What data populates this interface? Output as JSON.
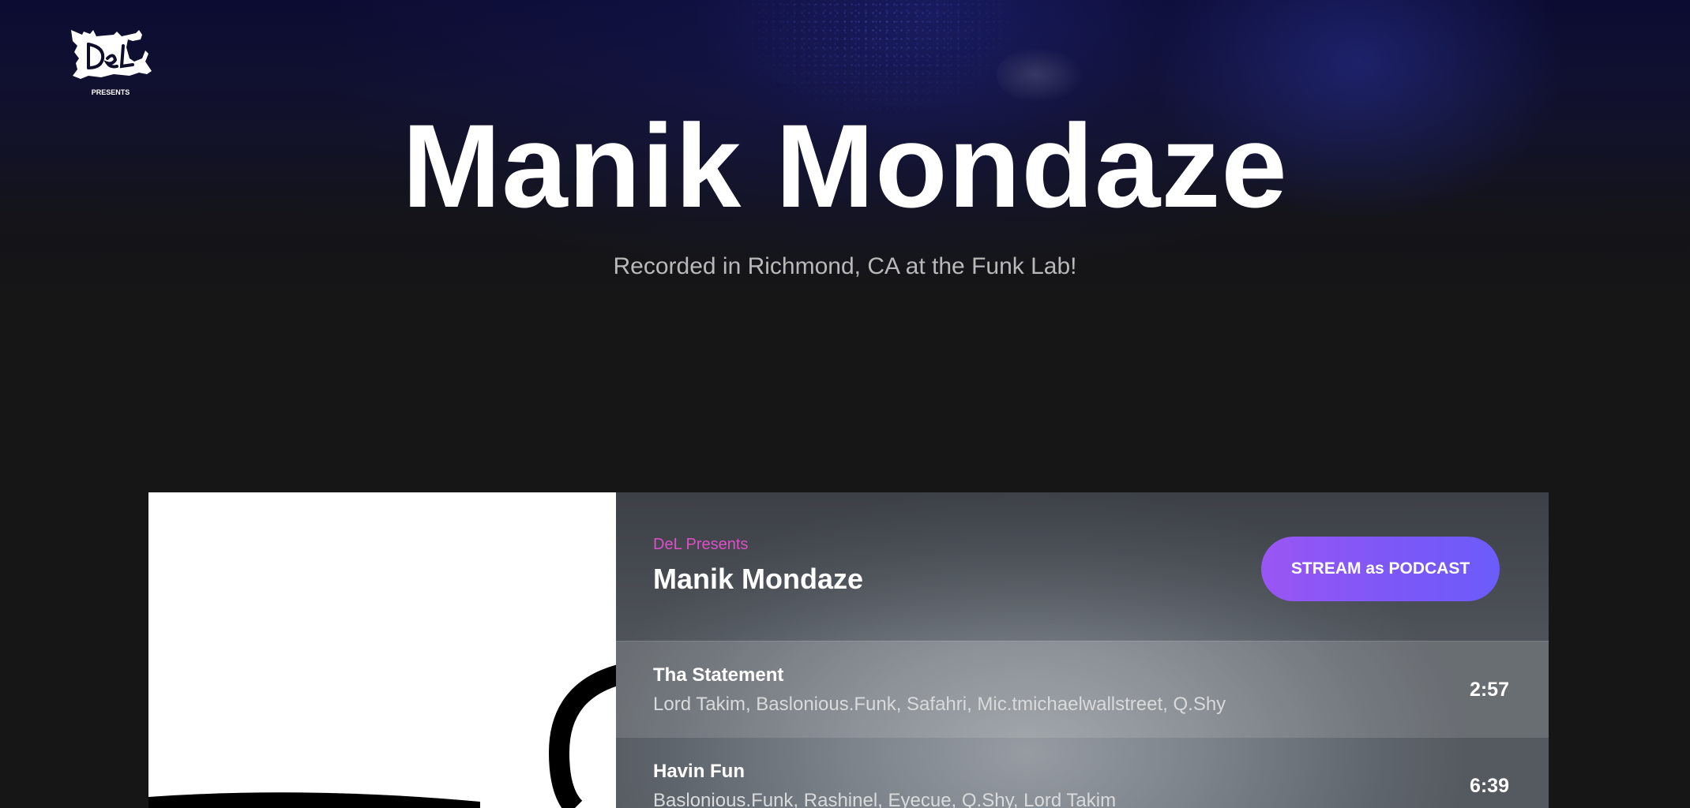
{
  "hero": {
    "logo_text": "DeL",
    "logo_sub": "PRESENTS",
    "title": "Manik Mondaze",
    "subtitle": "Recorded in Richmond, CA at the Funk Lab!"
  },
  "player": {
    "publisher": "DeL Presents",
    "album_title": "Manik Mondaze",
    "stream_button": "STREAM as PODCAST",
    "tracks": [
      {
        "title": "Tha Statement",
        "artists": "Lord Takim, Baslonious.Funk, Safahri, Mic.tmichaelwallstreet, Q.Shy",
        "duration": "2:57"
      },
      {
        "title": "Havin Fun",
        "artists": "Baslonious.Funk, Rashinel, Eyecue, Q.Shy, Lord Takim",
        "duration": "6:39"
      }
    ]
  },
  "colors": {
    "background": "#161616",
    "accent_pink": "#e04ec8",
    "button_gradient_start": "#9a56f4",
    "button_gradient_end": "#6b5cfa"
  }
}
